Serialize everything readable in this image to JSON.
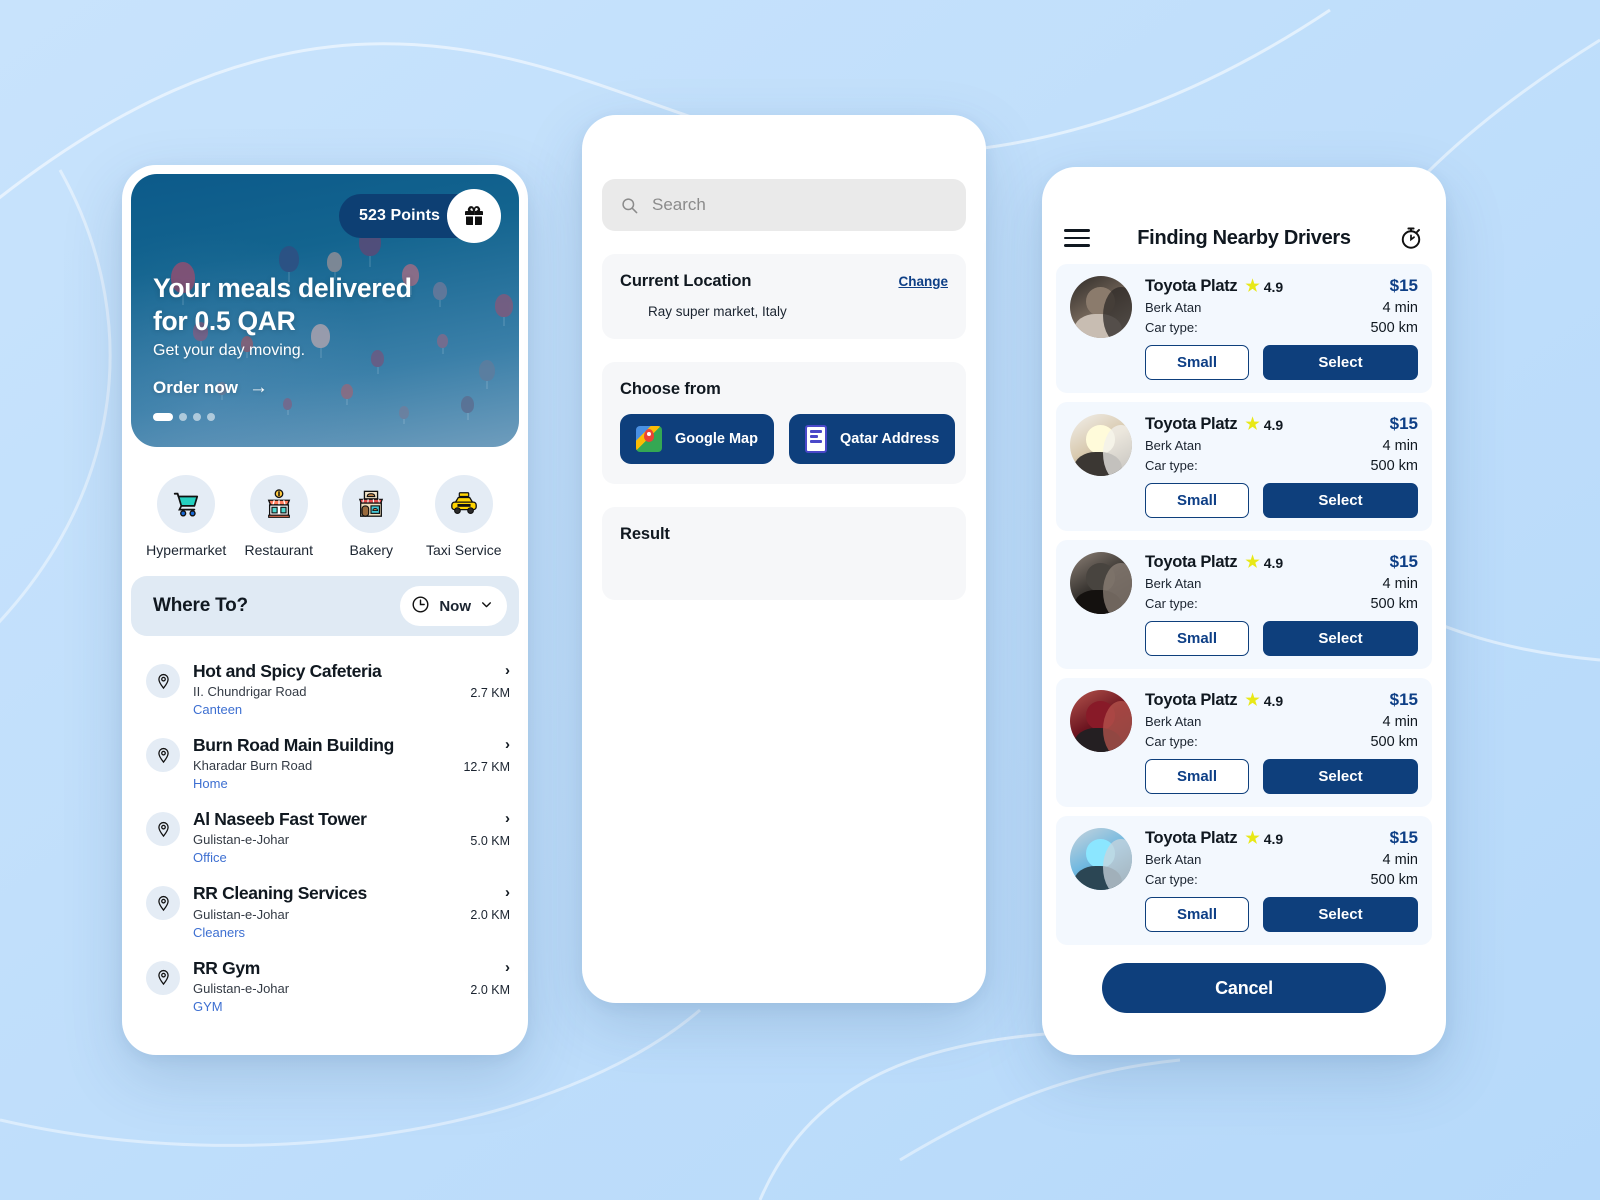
{
  "theme": {
    "background": "#bfdefb",
    "brand_navy": "#0e3f7c",
    "brand_link": "#3d6fd1",
    "card_tint": "#f3f8fe",
    "star_yellow": "#e8e817"
  },
  "left_phone": {
    "hero": {
      "points_label": "523 Points",
      "gift_icon": "gift-icon",
      "headline_line1": "Your meals delivered",
      "headline_line2": "for 0.5 QAR",
      "subtitle": "Get your day moving.",
      "cta": "Order now",
      "cta_arrow": "→",
      "dots_total": 4,
      "dots_active": 1
    },
    "categories": [
      {
        "label": "Hypermarket",
        "icon": "shopping-cart-icon",
        "glyph": "🛒"
      },
      {
        "label": "Restaurant",
        "icon": "restaurant-icon",
        "glyph": "🏪"
      },
      {
        "label": "Bakery",
        "icon": "bakery-icon",
        "glyph": "🏬"
      },
      {
        "label": "Taxi Service",
        "icon": "taxi-icon",
        "glyph": "🚕"
      }
    ],
    "whereto": {
      "title": "Where To?",
      "time_chip": {
        "clock_icon": "clock-icon",
        "value": "Now",
        "chevron": "⌄"
      }
    },
    "places": [
      {
        "name": "Hot and Spicy Cafeteria",
        "address": "II. Chundrigar Road",
        "tag": "Canteen",
        "distance": "2.7 KM"
      },
      {
        "name": "Burn Road Main Building",
        "address": "Kharadar Burn Road",
        "tag": "Home",
        "distance": "12.7 KM"
      },
      {
        "name": "Al Naseeb Fast Tower",
        "address": "Gulistan-e-Johar",
        "tag": "Office",
        "distance": "5.0 KM"
      },
      {
        "name": "RR Cleaning Services",
        "address": "Gulistan-e-Johar",
        "tag": "Cleaners",
        "distance": "2.0 KM"
      },
      {
        "name": "RR Gym",
        "address": "Gulistan-e-Johar",
        "tag": "GYM",
        "distance": "2.0 KM"
      }
    ]
  },
  "middle_phone": {
    "search": {
      "placeholder": "Search",
      "value": "",
      "icon": "search-icon"
    },
    "current_location": {
      "title": "Current Location",
      "change_label": "Change",
      "value": "Ray super market, Italy"
    },
    "choose_from": {
      "title": "Choose from",
      "options": [
        {
          "label": "Google Map",
          "icon": "google-map-icon"
        },
        {
          "label": "Qatar Address",
          "icon": "qatar-address-icon"
        }
      ]
    },
    "result": {
      "title": "Result",
      "items": []
    }
  },
  "right_phone": {
    "header": {
      "menu_icon": "hamburger-menu-icon",
      "title": "Finding Nearby Drivers",
      "timer_icon": "stopwatch-icon"
    },
    "drivers": [
      {
        "car": "Toyota Platz",
        "rating": "4.9",
        "driver": "Berk Atan",
        "car_type_label": "Car type:",
        "price": "$15",
        "eta": "4 min",
        "distance": "500 km",
        "size_label": "Small",
        "select_label": "Select",
        "avatar_colors": [
          "#6f6256",
          "#2e2a27",
          "#c8bdb2"
        ]
      },
      {
        "car": "Toyota Platz",
        "rating": "4.9",
        "driver": "Berk Atan",
        "car_type_label": "Car type:",
        "price": "$15",
        "eta": "4 min",
        "distance": "500 km",
        "size_label": "Small",
        "select_label": "Select",
        "avatar_colors": [
          "#d8c9ae",
          "#f2f0ec",
          "#3b3733"
        ]
      },
      {
        "car": "Toyota Platz",
        "rating": "4.9",
        "driver": "Berk Atan",
        "car_type_label": "Car type:",
        "price": "$15",
        "eta": "4 min",
        "distance": "500 km",
        "size_label": "Small",
        "select_label": "Select",
        "avatar_colors": [
          "#3a3632",
          "#8e8278",
          "#14110f"
        ]
      },
      {
        "car": "Toyota Platz",
        "rating": "4.9",
        "driver": "Berk Atan",
        "car_type_label": "Car type:",
        "price": "$15",
        "eta": "4 min",
        "distance": "500 km",
        "size_label": "Small",
        "select_label": "Select",
        "avatar_colors": [
          "#6d1520",
          "#b5564e",
          "#241f22"
        ]
      },
      {
        "car": "Toyota Platz",
        "rating": "4.9",
        "driver": "Berk Atan",
        "car_type_label": "Car type:",
        "price": "$15",
        "eta": "4 min",
        "distance": "500 km",
        "size_label": "Small",
        "select_label": "Select",
        "avatar_colors": [
          "#6fb8e0",
          "#c9d4dc",
          "#2b4654"
        ]
      }
    ],
    "cancel_label": "Cancel"
  }
}
